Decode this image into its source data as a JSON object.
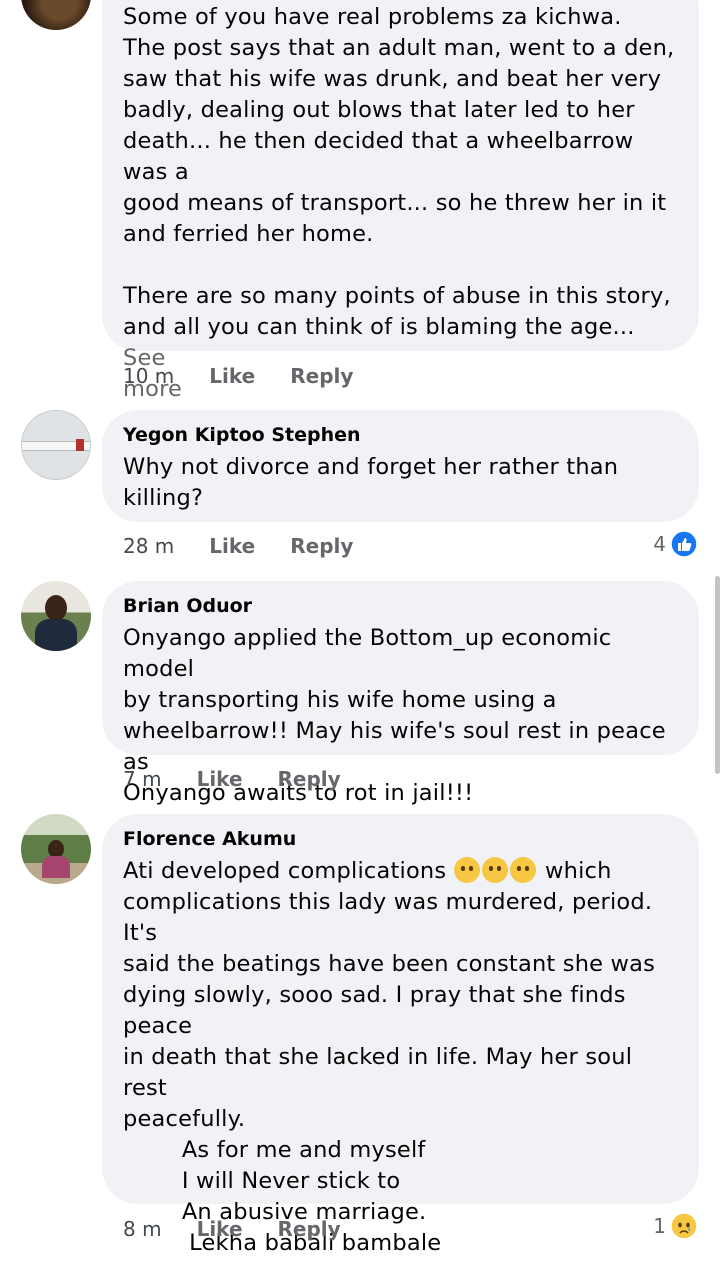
{
  "comments": [
    {
      "author": "",
      "lines": [
        "Some of you have real problems za kichwa.",
        "The post says that an adult man, went to a den,",
        "saw that his wife was drunk, and beat her very",
        "badly, dealing out blows that later led to her",
        "death... he then decided that a wheelbarrow was a",
        "good means of transport... so he threw her in it",
        "and ferried her home.",
        "",
        "There are so many points of abuse in this story,",
        "and all you can think of is blaming the age..."
      ],
      "see_more": "See",
      "see_more_2": "more",
      "time": "10 m",
      "like": "Like",
      "reply": "Reply"
    },
    {
      "author": "Yegon Kiptoo Stephen",
      "lines": [
        "Why not divorce and forget her rather than",
        "killing?"
      ],
      "time": "28 m",
      "like": "Like",
      "reply": "Reply",
      "reaction_count": "4",
      "reaction_icon": "like-reaction-icon",
      "reaction_color": "#1877f2"
    },
    {
      "author": "Brian Oduor",
      "lines": [
        "Onyango applied the Bottom_up economic model",
        "by transporting his wife home using a",
        "wheelbarrow!! May his wife's soul rest in peace as",
        "Onyango awaits to rot in jail!!!"
      ],
      "time": "7 m",
      "like": "Like",
      "reply": "Reply"
    },
    {
      "author": "Florence Akumu",
      "line1_before": "Ati developed complications",
      "line1_emojis": "thinking-face-emoji x3",
      "line1_after": " which",
      "lines": [
        "complications this lady was murdered, period. It's",
        "said the beatings have been constant she was",
        "dying slowly, sooo sad. I pray that she finds peace",
        "in death that she lacked in life. May her soul rest",
        "peacefully.",
        "        As for me and myself",
        "        I will Never stick to",
        "        An abusive marriage.",
        "         Lekha babali bambale"
      ],
      "time": "8 m",
      "like": "Like",
      "reply": "Reply",
      "reaction_count": "1",
      "reaction_icon": "sad-reaction-icon"
    }
  ]
}
